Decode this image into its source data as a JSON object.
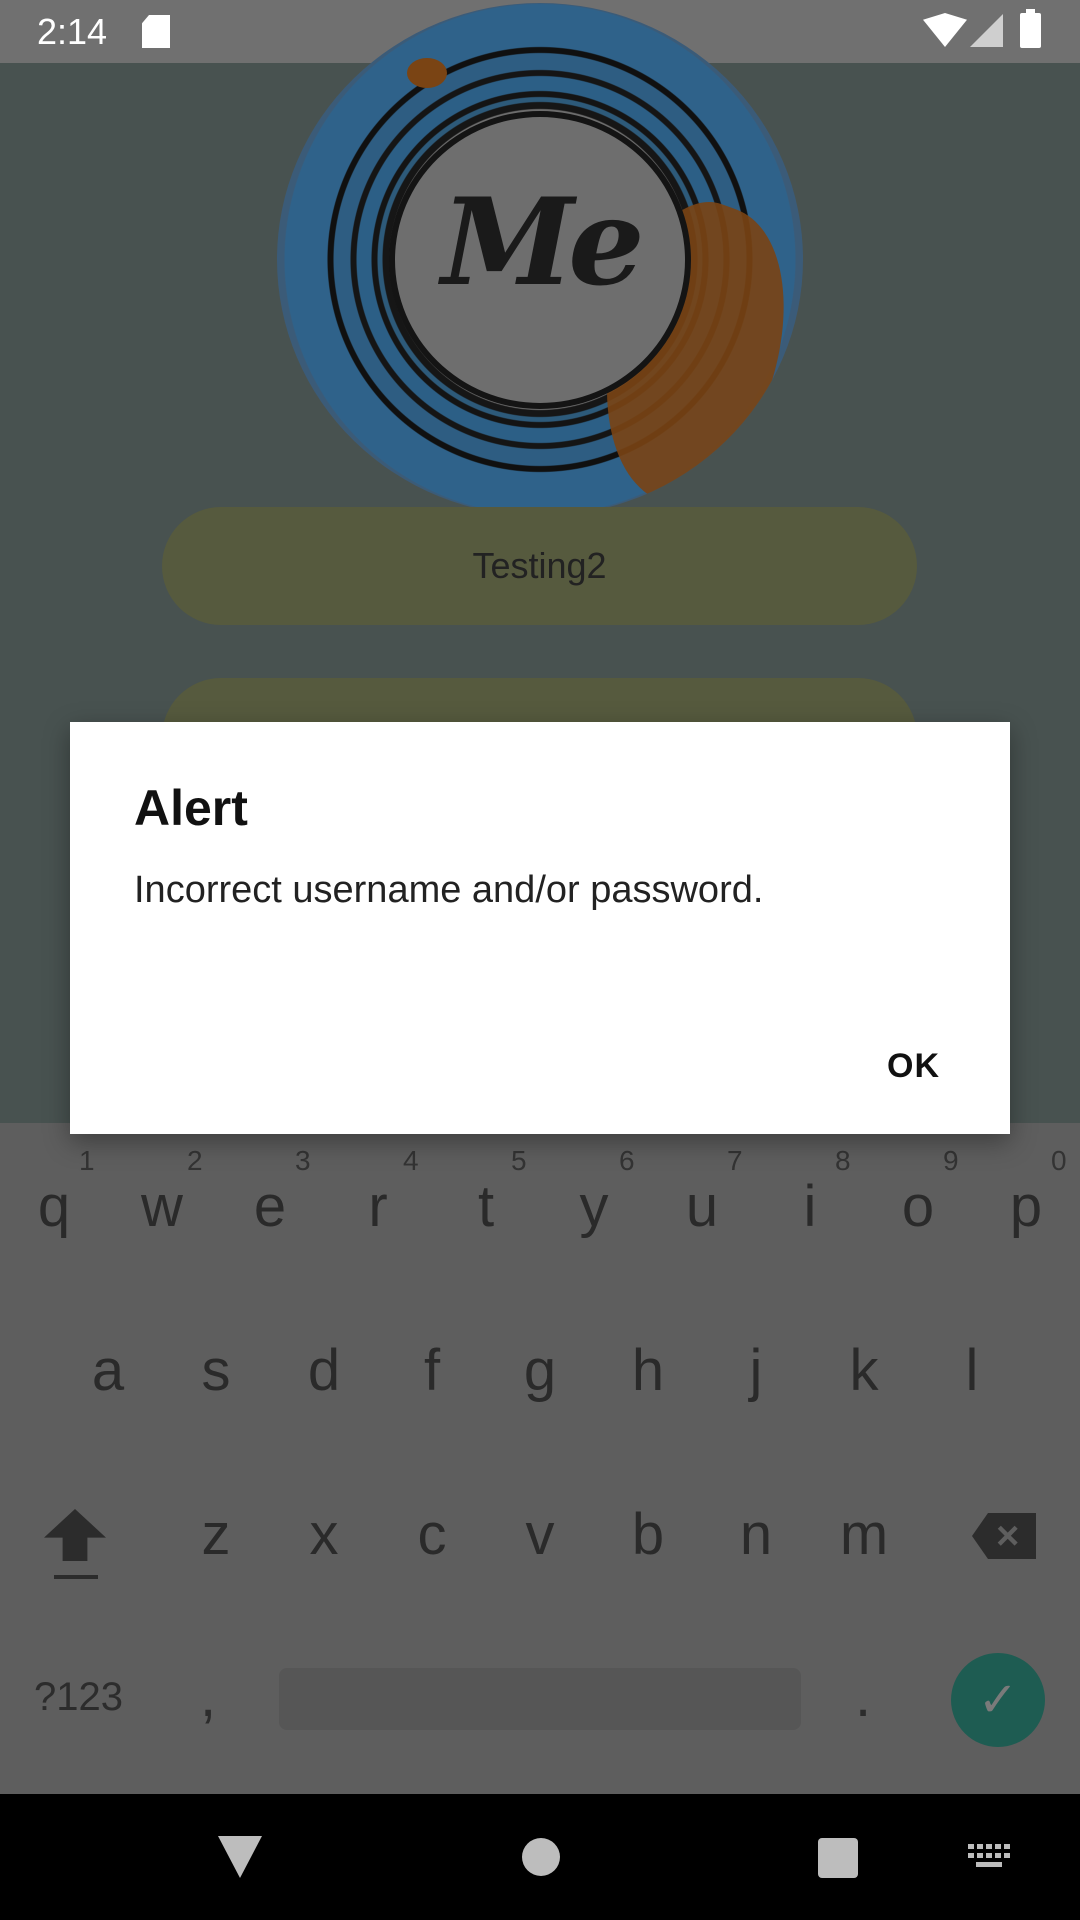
{
  "status_bar": {
    "time": "2:14"
  },
  "app": {
    "username_value": "Testing2",
    "password_value": ""
  },
  "dialog": {
    "title": "Alert",
    "message": "Incorrect username and/or password.",
    "ok_label": "OK"
  },
  "keyboard": {
    "row1": [
      "q",
      "w",
      "e",
      "r",
      "t",
      "y",
      "u",
      "i",
      "o",
      "p"
    ],
    "row1_hints": [
      "1",
      "2",
      "3",
      "4",
      "5",
      "6",
      "7",
      "8",
      "9",
      "0"
    ],
    "row2": [
      "a",
      "s",
      "d",
      "f",
      "g",
      "h",
      "j",
      "k",
      "l"
    ],
    "row3": [
      "z",
      "x",
      "c",
      "v",
      "b",
      "n",
      "m"
    ],
    "symbols_label": "?123",
    "comma": ",",
    "period": ".",
    "enter_glyph": "✓"
  },
  "icons": {
    "statusbar": [
      "sd-card-icon",
      "wifi-icon",
      "signal-icon",
      "battery-icon"
    ],
    "navbar": [
      "back-icon",
      "home-icon",
      "recents-icon",
      "keyboard-icon"
    ]
  },
  "colors": {
    "enter_key": "#1e5c52",
    "dialog_bg": "#ffffff"
  }
}
